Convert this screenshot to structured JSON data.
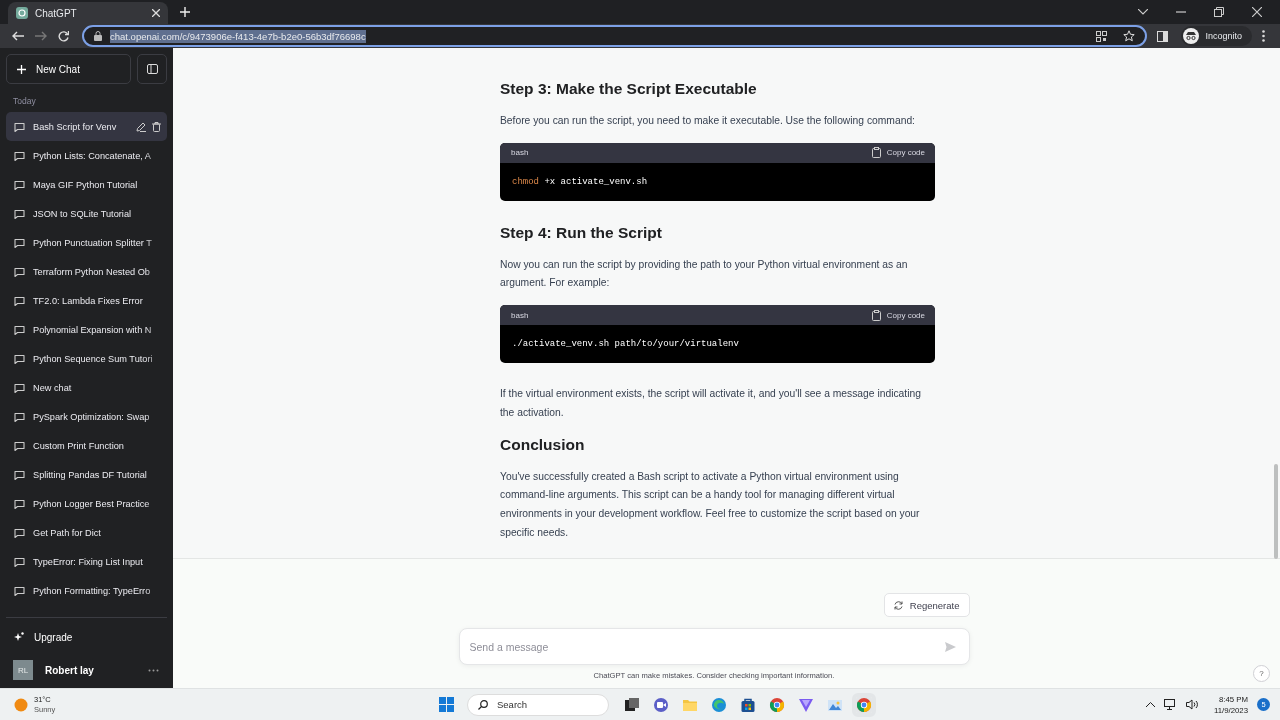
{
  "browser": {
    "tab": {
      "title": "ChatGPT"
    },
    "url": "chat.openai.com/c/9473906e-f413-4e7b-b2e0-56b3df76698c",
    "profile": "Incognito"
  },
  "sidebar": {
    "new_chat": "New Chat",
    "section": "Today",
    "items": [
      {
        "title": "Bash Script for Venv",
        "selected": true
      },
      {
        "title": "Python Lists: Concatenate, A",
        "selected": false
      },
      {
        "title": "Maya GIF Python Tutorial",
        "selected": false
      },
      {
        "title": "JSON to SQLite Tutorial",
        "selected": false
      },
      {
        "title": "Python Punctuation Splitter T",
        "selected": false
      },
      {
        "title": "Terraform Python Nested Ob",
        "selected": false
      },
      {
        "title": "TF2.0: Lambda Fixes Error",
        "selected": false
      },
      {
        "title": "Polynomial Expansion with N",
        "selected": false
      },
      {
        "title": "Python Sequence Sum Tutori",
        "selected": false
      },
      {
        "title": "New chat",
        "selected": false
      },
      {
        "title": "PySpark Optimization: Swap",
        "selected": false
      },
      {
        "title": "Custom Print Function",
        "selected": false
      },
      {
        "title": "Splitting Pandas DF Tutorial",
        "selected": false
      },
      {
        "title": "Python Logger Best Practice",
        "selected": false
      },
      {
        "title": "Get Path for Dict",
        "selected": false
      },
      {
        "title": "TypeError: Fixing List Input",
        "selected": false
      },
      {
        "title": "Python Formatting: TypeErro",
        "selected": false
      }
    ],
    "upgrade": "Upgrade",
    "user": {
      "initials": "RL",
      "name": "Robert lay"
    }
  },
  "content": {
    "blocks": [
      {
        "kind": "heading",
        "text": "Step 3: Make the Script Executable"
      },
      {
        "kind": "paragraph",
        "text": "Before you can run the script, you need to make it executable. Use the following command:"
      },
      {
        "kind": "code",
        "language": "bash",
        "copy_label": "Copy code",
        "tokens": [
          {
            "kind": "command",
            "text": "chmod"
          },
          {
            "kind": "plain",
            "text": " +x activate_venv.sh"
          }
        ]
      },
      {
        "kind": "heading",
        "text": "Step 4: Run the Script"
      },
      {
        "kind": "paragraph",
        "text": "Now you can run the script by providing the path to your Python virtual environment as an argument. For example:"
      },
      {
        "kind": "code",
        "language": "bash",
        "copy_label": "Copy code",
        "tokens": [
          {
            "kind": "plain",
            "text": "./activate_venv.sh path/to/your/virtualenv"
          }
        ]
      },
      {
        "kind": "paragraph",
        "text": "If the virtual environment exists, the script will activate it, and you'll see a message indicating the activation."
      },
      {
        "kind": "heading",
        "text": "Conclusion"
      },
      {
        "kind": "paragraph",
        "text": "You've successfully created a Bash script to activate a Python virtual environment using command-line arguments. This script can be a handy tool for managing different virtual environments in your development workflow. Feel free to customize the script based on your specific needs."
      }
    ]
  },
  "regenerate": "Regenerate",
  "composer": {
    "placeholder": "Send a message"
  },
  "disclaimer": "ChatGPT can make mistakes. Consider checking important information.",
  "help": "?",
  "taskbar": {
    "weather": {
      "temp": "31°C",
      "condition": "Sunny"
    },
    "search": "Search",
    "time": "8:45 PM",
    "date": "11/9/2023",
    "badge": "5"
  }
}
